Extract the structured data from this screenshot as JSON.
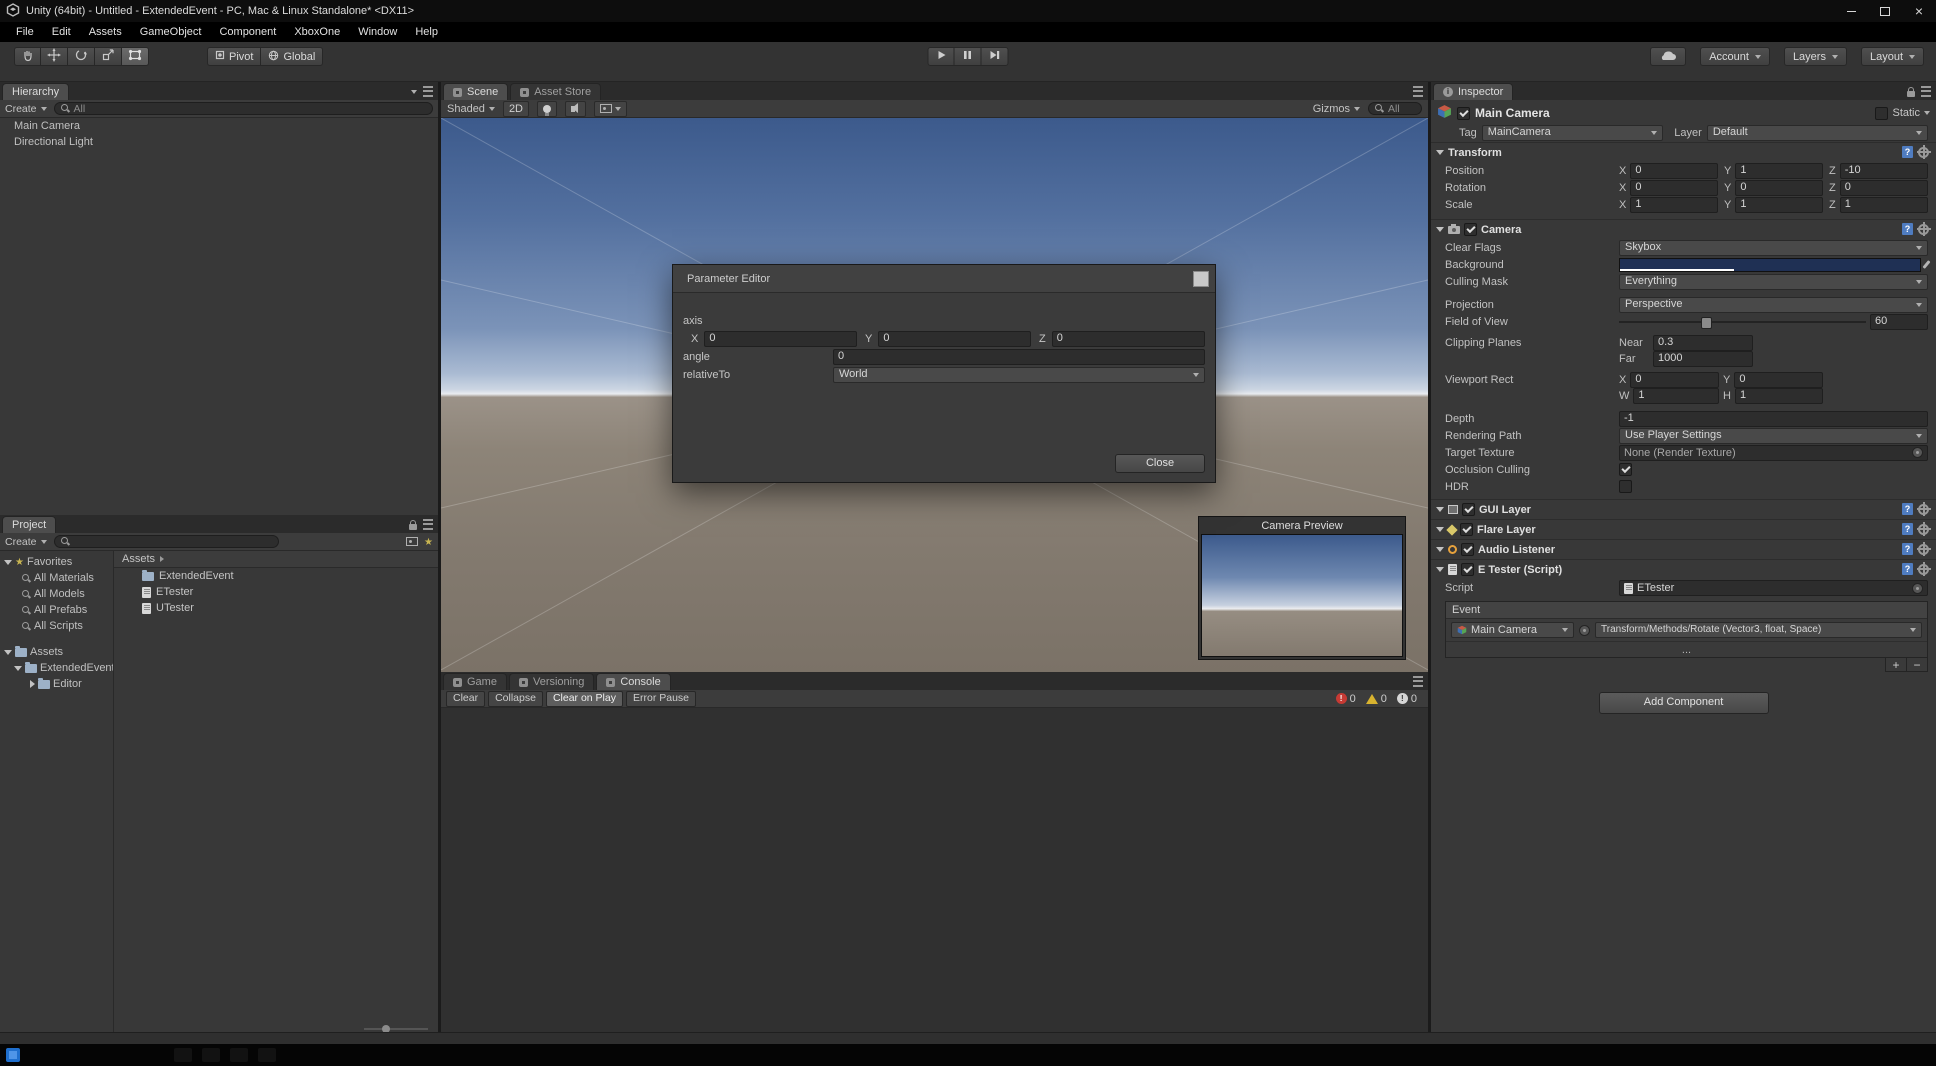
{
  "window": {
    "title": "Unity (64bit) - Untitled - ExtendedEvent - PC, Mac & Linux Standalone* <DX11>",
    "menus": [
      "File",
      "Edit",
      "Assets",
      "GameObject",
      "Component",
      "XboxOne",
      "Window",
      "Help"
    ]
  },
  "toolbar": {
    "pivot": "Pivot",
    "global": "Global",
    "account": "Account",
    "layers": "Layers",
    "layout": "Layout"
  },
  "hierarchy": {
    "tab": "Hierarchy",
    "create": "Create",
    "search": "All",
    "items": [
      {
        "label": "Main Camera"
      },
      {
        "label": "Directional Light"
      }
    ]
  },
  "project": {
    "tab": "Project",
    "create": "Create",
    "favorites_label": "Favorites",
    "favorites": [
      {
        "label": "All Materials"
      },
      {
        "label": "All Models"
      },
      {
        "label": "All Prefabs"
      },
      {
        "label": "All Scripts"
      }
    ],
    "assets_root": "Assets",
    "folder_extendedevent": "ExtendedEvent",
    "folder_editor": "Editor",
    "breadcrumb": "Assets",
    "files": [
      {
        "label": "ExtendedEvent"
      },
      {
        "label": "ETester"
      },
      {
        "label": "UTester"
      }
    ]
  },
  "scene": {
    "tab_scene": "Scene",
    "tab_store": "Asset Store",
    "shaded": "Shaded",
    "two_d": "2D",
    "gizmos": "Gizmos",
    "search": "All",
    "camera_preview": "Camera Preview"
  },
  "dialog": {
    "title": "Parameter Editor",
    "axis_label": "axis",
    "x_label": "X",
    "x_value": "0",
    "y_label": "Y",
    "y_value": "0",
    "z_label": "Z",
    "z_value": "0",
    "angle_label": "angle",
    "angle_value": "0",
    "relative_label": "relativeTo",
    "relative_value": "World",
    "close": "Close"
  },
  "console": {
    "tab_game": "Game",
    "tab_versioning": "Versioning",
    "tab_console": "Console",
    "clear": "Clear",
    "collapse": "Collapse",
    "clear_on_play": "Clear on Play",
    "error_pause": "Error Pause",
    "error_count": "0",
    "warning_count": "0",
    "info_count": "0"
  },
  "inspector": {
    "tab": "Inspector",
    "name": "Main Camera",
    "static_label": "Static",
    "tag_label": "Tag",
    "tag": "MainCamera",
    "layer_label": "Layer",
    "layer": "Default",
    "transform": {
      "title": "Transform",
      "x": "X",
      "y": "Y",
      "z": "Z",
      "rows": [
        {
          "label": "Position",
          "x": "0",
          "y": "1",
          "z": "-10"
        },
        {
          "label": "Rotation",
          "x": "0",
          "y": "0",
          "z": "0"
        },
        {
          "label": "Scale",
          "x": "1",
          "y": "1",
          "z": "1"
        }
      ]
    },
    "camera": {
      "title": "Camera",
      "clear_flags_label": "Clear Flags",
      "clear_flags": "Skybox",
      "background_label": "Background",
      "background_color": "#1f3054",
      "culling_label": "Culling Mask",
      "culling": "Everything",
      "projection_label": "Projection",
      "projection": "Perspective",
      "fov_label": "Field of View",
      "fov": "60",
      "clipping_label": "Clipping Planes",
      "near_label": "Near",
      "near": "0.3",
      "far_label": "Far",
      "far": "1000",
      "viewport_label": "Viewport Rect",
      "vx_label": "X",
      "vx": "0",
      "vy_label": "Y",
      "vy": "0",
      "vw_label": "W",
      "vw": "1",
      "vh_label": "H",
      "vh": "1",
      "depth_label": "Depth",
      "depth": "-1",
      "rendering_label": "Rendering Path",
      "rendering": "Use Player Settings",
      "target_label": "Target Texture",
      "target": "None (Render Texture)",
      "occlusion_label": "Occlusion Culling",
      "hdr_label": "HDR"
    },
    "gui_layer": "GUI Layer",
    "flare_layer": "Flare Layer",
    "audio_listener": "Audio Listener",
    "etester_title": "E Tester (Script)",
    "script_label": "Script",
    "script": "ETester",
    "event": {
      "title": "Event",
      "target": "Main Camera",
      "method": "Transform/Methods/Rotate (Vector3, float, Space)",
      "more": "...",
      "add": "+",
      "remove": "−"
    },
    "add_component": "Add Component"
  }
}
